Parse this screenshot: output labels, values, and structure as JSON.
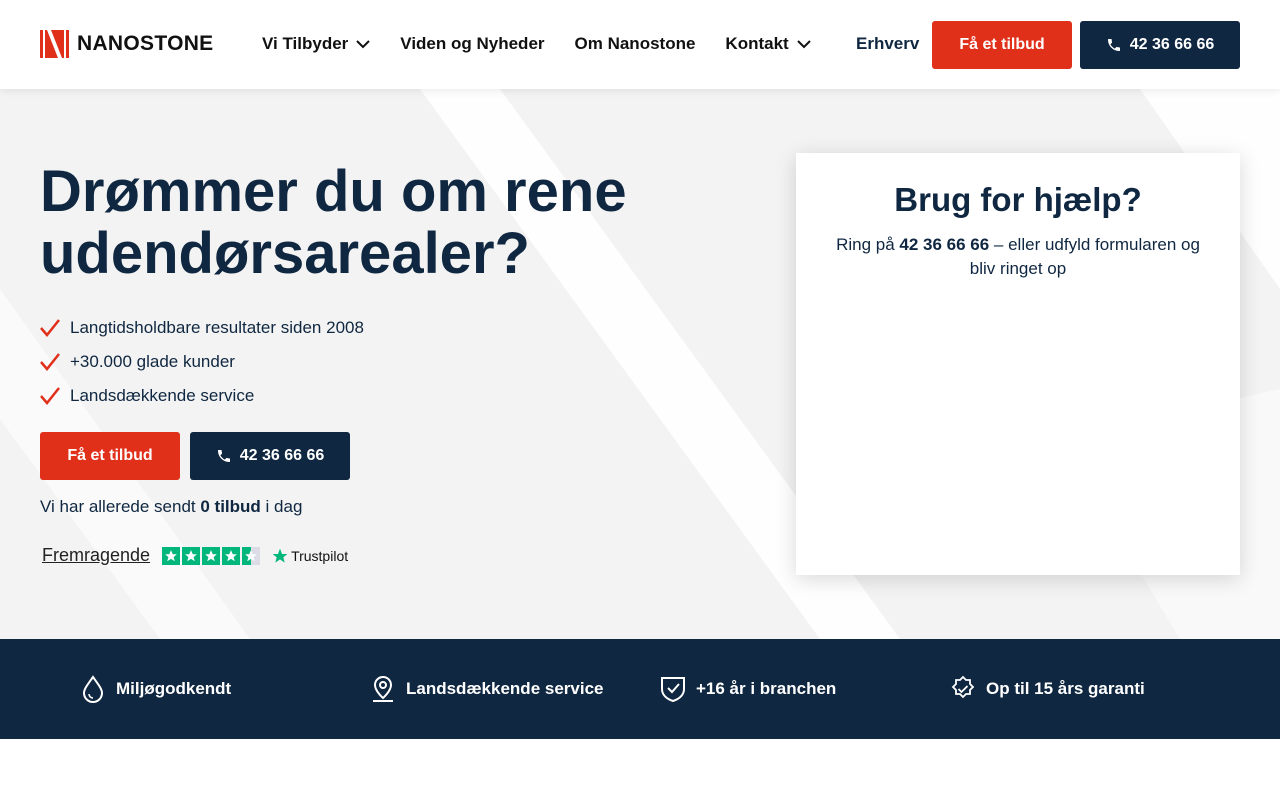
{
  "header": {
    "logo_text": "NANOSTONE",
    "nav": [
      {
        "label": "Vi Tilbyder",
        "has_dropdown": true
      },
      {
        "label": "Viden og Nyheder",
        "has_dropdown": false
      },
      {
        "label": "Om Nanostone",
        "has_dropdown": false
      },
      {
        "label": "Kontakt",
        "has_dropdown": true
      }
    ],
    "erhverv": "Erhverv",
    "quote_button": "Få et tilbud",
    "phone_button": "42 36 66 66"
  },
  "hero": {
    "title": "Drømmer du om rene udendørsarealer?",
    "checks": [
      "Langtidsholdbare resultater siden 2008",
      "+30.000 glade kunder",
      "Landsdækkende service"
    ],
    "quote_button": "Få et tilbud",
    "phone_button": "42 36 66 66",
    "sent_prefix": "Vi har allerede sendt ",
    "sent_count": "0 tilbud",
    "sent_suffix": " i dag",
    "trustpilot_label": "Fremragende",
    "trustpilot_brand": "Trustpilot",
    "trustpilot_rating": 4.5
  },
  "help_card": {
    "title": "Brug for hjælp?",
    "text_prefix": "Ring på ",
    "phone": "42 36 66 66",
    "text_suffix": " – eller udfyld formularen og bliv ringet op"
  },
  "usp": [
    {
      "icon": "drop-icon",
      "label": "Miljøgodkendt"
    },
    {
      "icon": "location-pin-icon",
      "label": "Landsdækkende service"
    },
    {
      "icon": "shield-check-icon",
      "label": "+16 år i branchen"
    },
    {
      "icon": "badge-check-icon",
      "label": "Op til 15 års garanti"
    }
  ],
  "colors": {
    "brand_red": "#e1301a",
    "navy": "#0f2740",
    "trustpilot_green": "#00b67a"
  }
}
